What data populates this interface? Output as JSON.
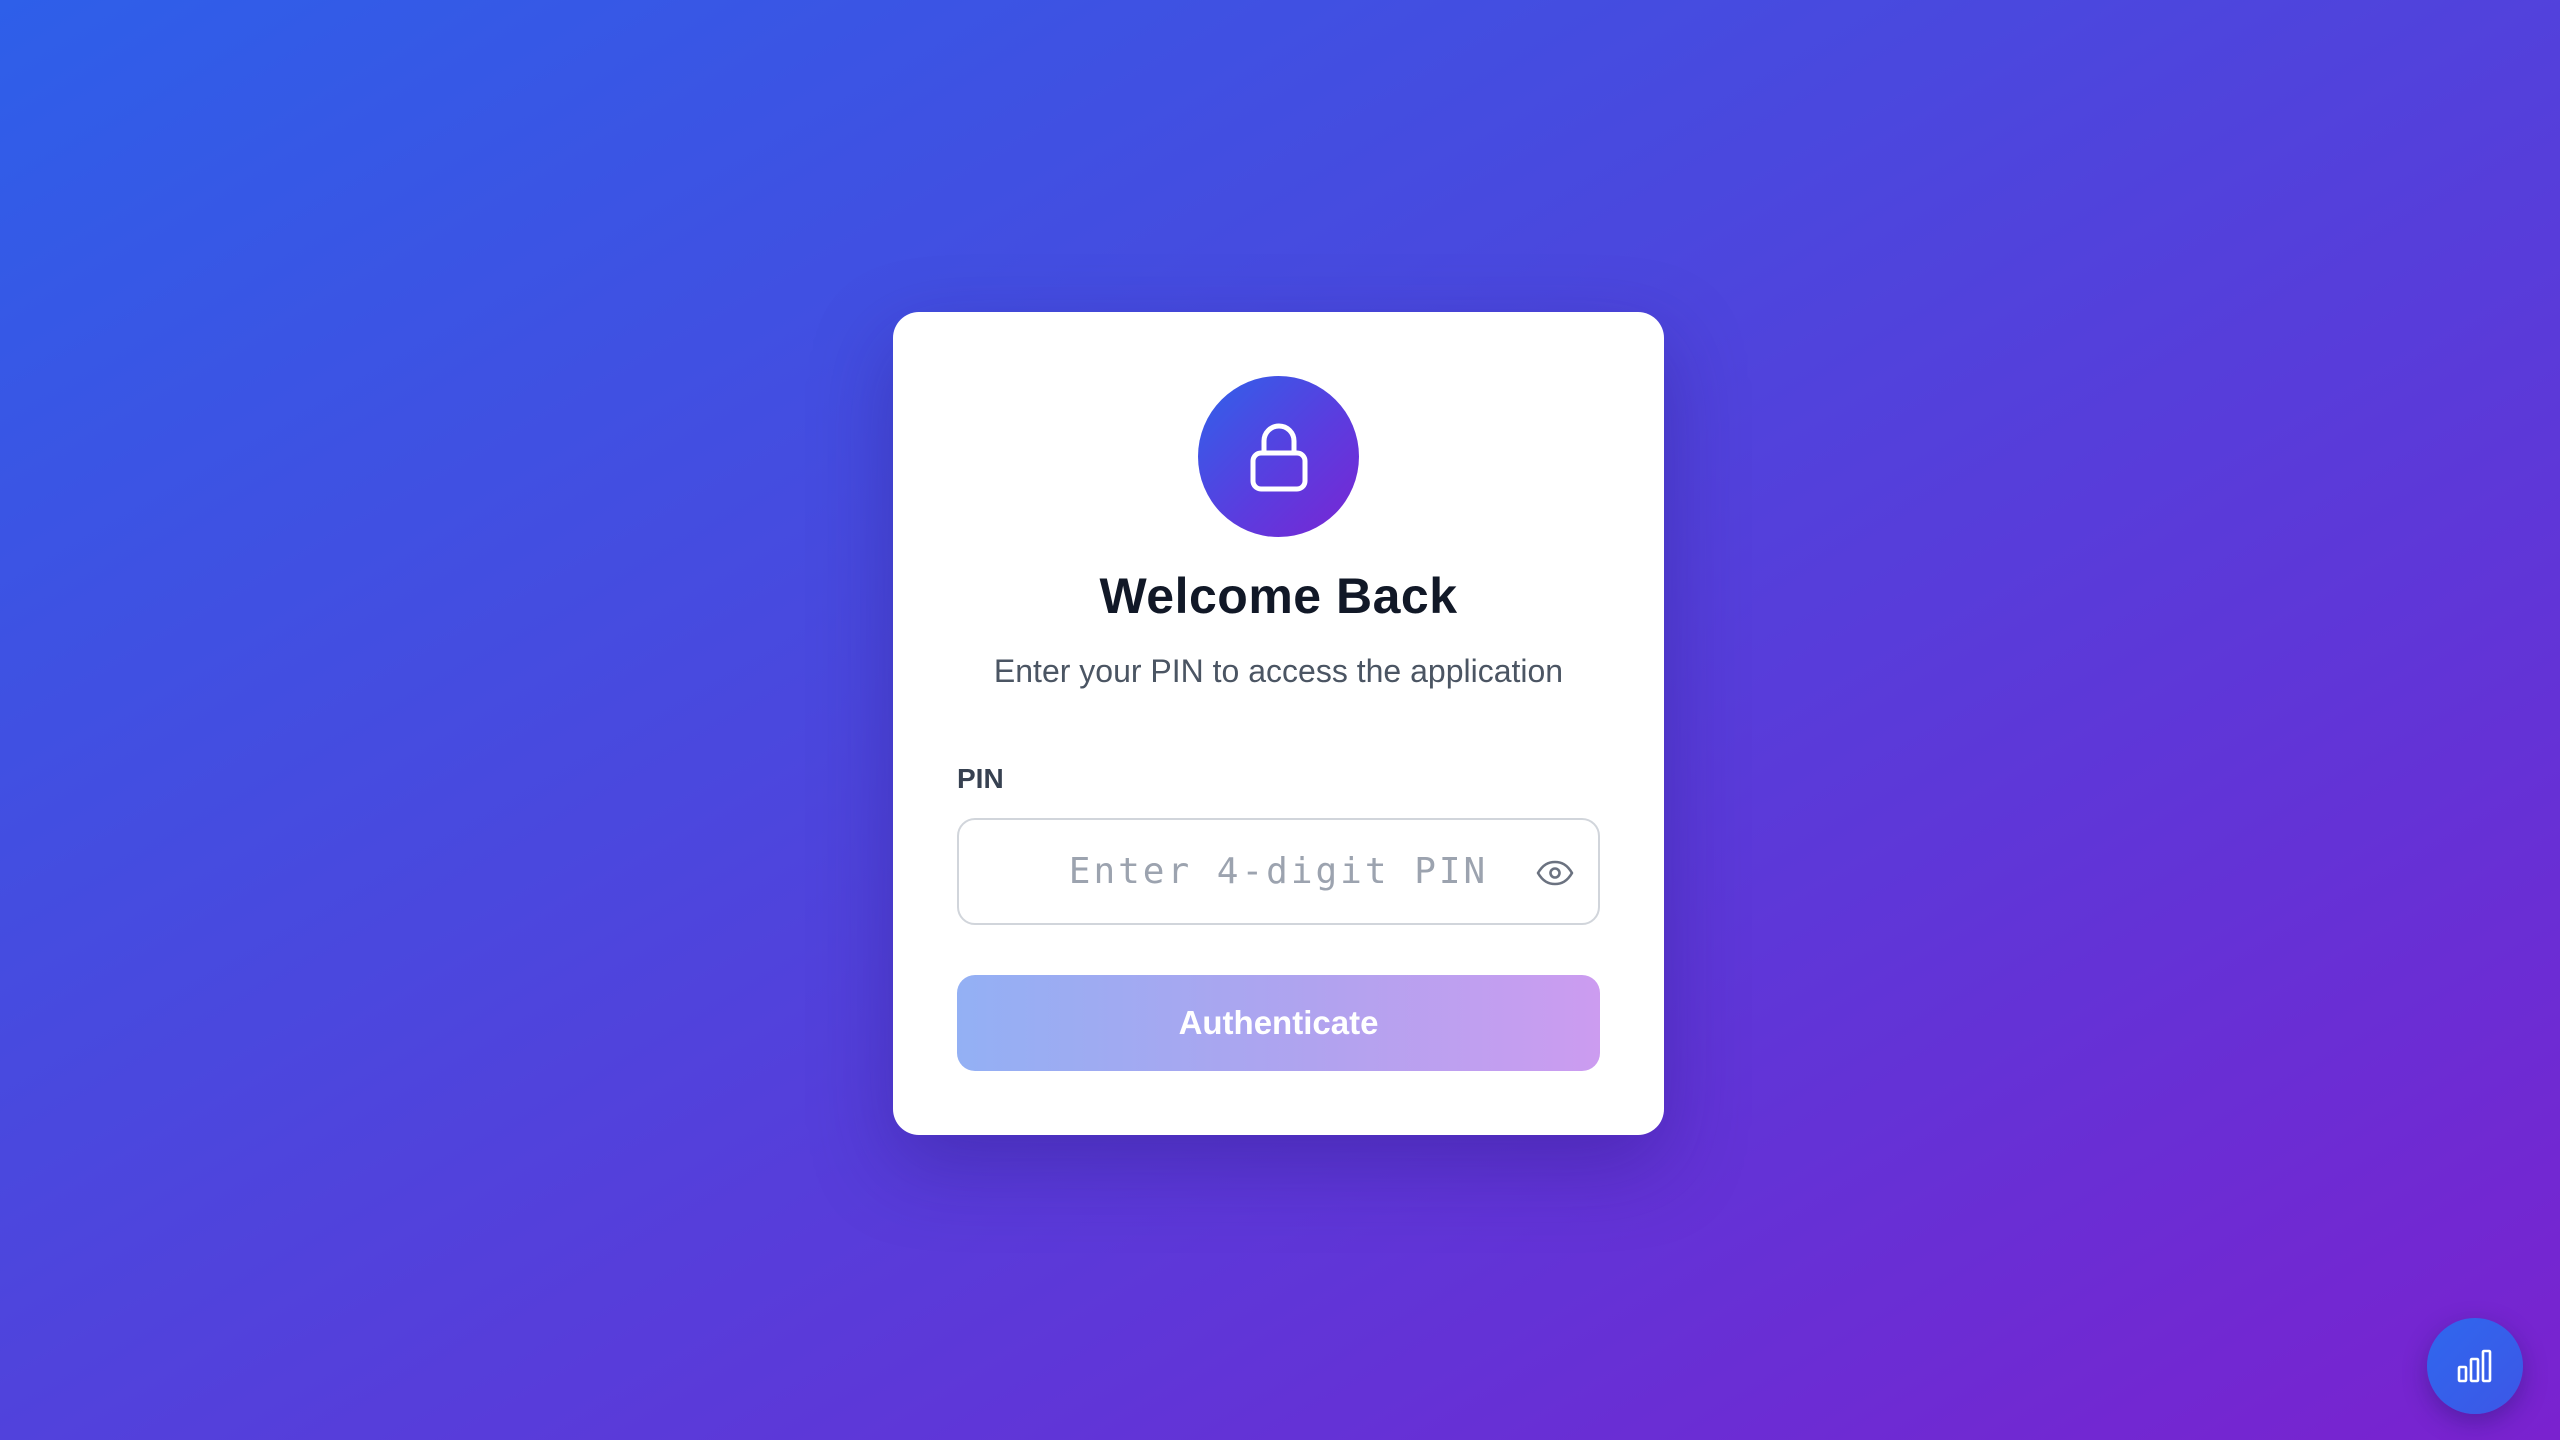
{
  "login": {
    "title": "Welcome Back",
    "subtitle": "Enter your PIN to access the application",
    "pin_label": "PIN",
    "pin_placeholder": "Enter 4-digit PIN",
    "pin_value": "",
    "submit_label": "Authenticate",
    "lock_icon": "lock-icon",
    "toggle_icon": "eye-icon"
  },
  "fab": {
    "icon": "bar-chart-icon"
  },
  "colors": {
    "background_start": "#2e5fe9",
    "background_end": "#7a22cf",
    "title": "#111827",
    "subtitle": "#4b5563",
    "button_start": "#93b0f4",
    "button_end": "#cc9cf0"
  }
}
